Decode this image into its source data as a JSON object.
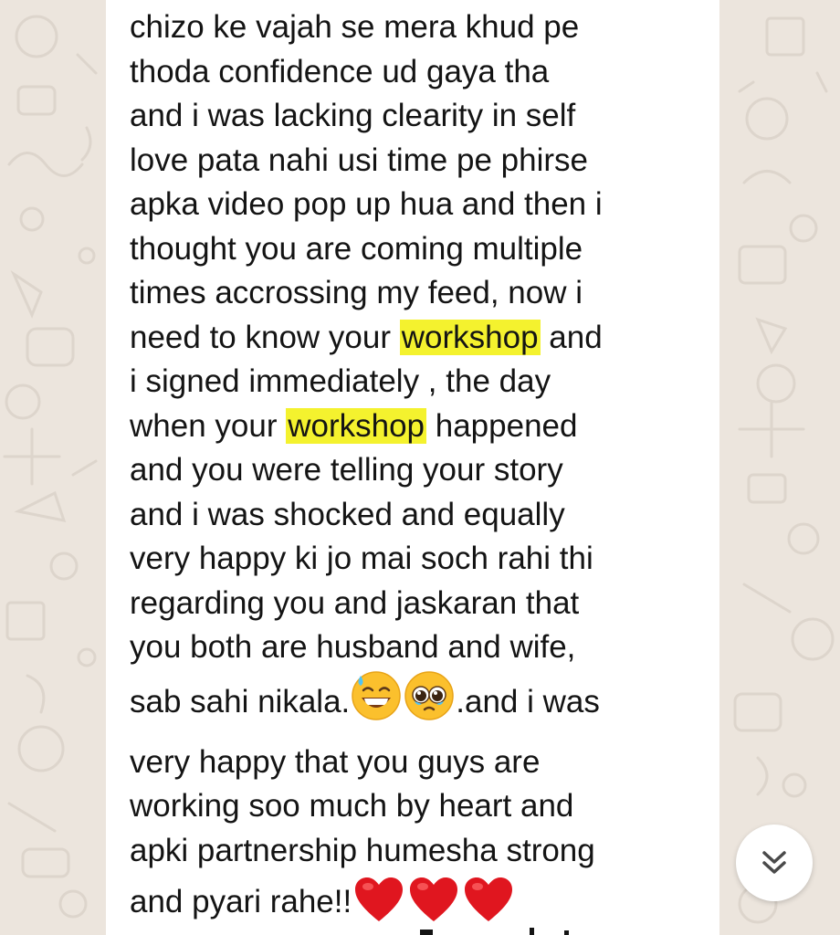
{
  "colors": {
    "wallpaper": "#ece5dd",
    "bubble": "#ffffff",
    "text": "#141414",
    "highlight": "#f4f22e",
    "heart": "#e0161f"
  },
  "message": {
    "lines": [
      "chizo ke vajah se mera khud pe",
      "thoda confidence ud gaya tha",
      "and i was lacking clearity in self",
      "love pata nahi usi time pe phirse",
      "apka video pop up hua and then i",
      "thought you are coming multiple",
      "times accrossing my feed, now i"
    ],
    "line8": {
      "before": "need to know your ",
      "highlight": "workshop",
      "after": " and"
    },
    "line9": "i signed immediately , the day",
    "line10": {
      "before": "when your ",
      "highlight": "workshop",
      "after": " happened"
    },
    "lines_b": [
      "and you were telling your story",
      "and i was shocked and equally",
      "very happy ki jo mai soch rahi thi",
      "regarding you and jaskaran that",
      "you both are husband and wife,"
    ],
    "emoji_line": {
      "before": "sab sahi nikala.",
      "after": ".and i was"
    },
    "lines_c": [
      "very happy that you guys are",
      "working soo much by heart and",
      "apki partnership humesha strong"
    ],
    "last_line": "and pyari rahe!!",
    "emojis": [
      "grinning-sweat-emoji",
      "pleading-face-emoji"
    ],
    "hearts": [
      "red-heart-emoji",
      "red-heart-emoji",
      "red-heart-emoji"
    ]
  },
  "scroll_button": {
    "icon": "double-chevron-down-icon"
  }
}
